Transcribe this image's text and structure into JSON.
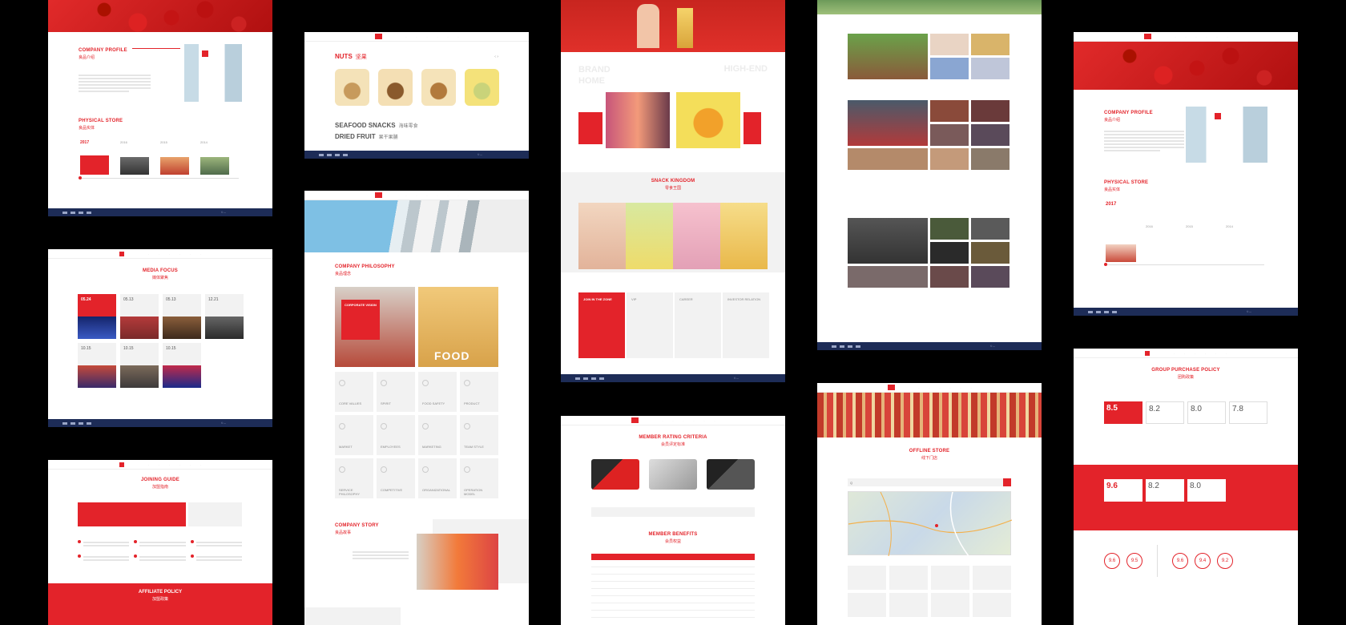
{
  "panel1": {
    "company_profile_en": "COMPANY PROFILE",
    "company_profile_cn": "良品介绍",
    "physical_store_en": "PHYSICAL STORE",
    "physical_store_cn": "良品实体",
    "years": [
      "2017",
      "2016",
      "2015",
      "2014"
    ]
  },
  "panel2": {
    "media_focus_en": "MEDIA FOCUS",
    "media_focus_cn": "媒体聚焦",
    "dates": [
      "05.24",
      "05.13",
      "05.13",
      "12.21",
      "10.15",
      "10.15",
      "10.15"
    ]
  },
  "panel3": {
    "joining_guide_en": "JOINING GUIDE",
    "joining_guide_cn": "加盟指南",
    "affiliate_policy_en": "AFFILIATE POLICY",
    "affiliate_policy_cn": "加盟政策"
  },
  "panel4": {
    "nuts_en": "NUTS",
    "nuts_cn": "坚果",
    "seafood_en": "SEAFOOD SNACKS",
    "seafood_cn": "海味零食",
    "dried_en": "DRIED FRUIT",
    "dried_cn": "果干果脯"
  },
  "panel5": {
    "philosophy_en": "COMPANY PHILOSOPHY",
    "philosophy_cn": "良品理念",
    "corporate_vision": "CORPORATE VISION",
    "food_word": "FOOD",
    "grid": [
      {
        "en": "CORE VALUES"
      },
      {
        "en": "SPIRIT"
      },
      {
        "en": "FOOD SAFETY"
      },
      {
        "en": "PRODUCT"
      },
      {
        "en": "MARKET"
      },
      {
        "en": "EMPLOYEES"
      },
      {
        "en": "MARKETING"
      },
      {
        "en": "TEAM STYLE"
      },
      {
        "en": "SERVICE PHILOSOPHY"
      },
      {
        "en": "COMPETITIVE"
      },
      {
        "en": "ORGANIZATIONAL"
      },
      {
        "en": "OPERATION MODEL"
      }
    ],
    "story_en": "COMPANY STORY",
    "story_cn": "良品故事"
  },
  "panel6": {
    "snack_kingdom_en": "SNACK KINGDOM",
    "snack_kingdom_cn": "零食王国",
    "bg_words": [
      "BRAND",
      "HIGH-END",
      "HOME"
    ],
    "zone_tiles": [
      "JOIN IN THE ZONE",
      "VIP",
      "CAREER",
      "INVESTOR RELATION"
    ]
  },
  "panel7": {
    "member_rating_en": "MEMBER RATING CRITERIA",
    "member_rating_cn": "会员评定标准",
    "member_benefits_en": "MEMBER BENEFITS",
    "member_benefits_cn": "会员权益"
  },
  "panel9": {
    "offline_store_en": "OFFLINE STORE",
    "offline_store_cn": "线下门店",
    "search_placeholder": "Q"
  },
  "panel10": {
    "company_profile_en": "COMPANY PROFILE",
    "company_profile_cn": "良品介绍",
    "physical_store_en": "PHYSICAL STORE",
    "physical_store_cn": "良品实体",
    "years": [
      "2017",
      "2016",
      "2015",
      "2014"
    ]
  },
  "panel11": {
    "group_purchase_en": "GROUP PURCHASE POLICY",
    "group_purchase_cn": "团购政策",
    "discounts_row1": [
      "8.5",
      "8.2",
      "8.0",
      "7.8"
    ],
    "discounts_row2": [
      "9.6",
      "8.2",
      "8.0"
    ],
    "circles": [
      "9.6",
      "9.5",
      "9.6",
      "9.4",
      "9.2"
    ]
  },
  "colors": {
    "brand_red": "#e3232a",
    "navy": "#1e2d55"
  }
}
